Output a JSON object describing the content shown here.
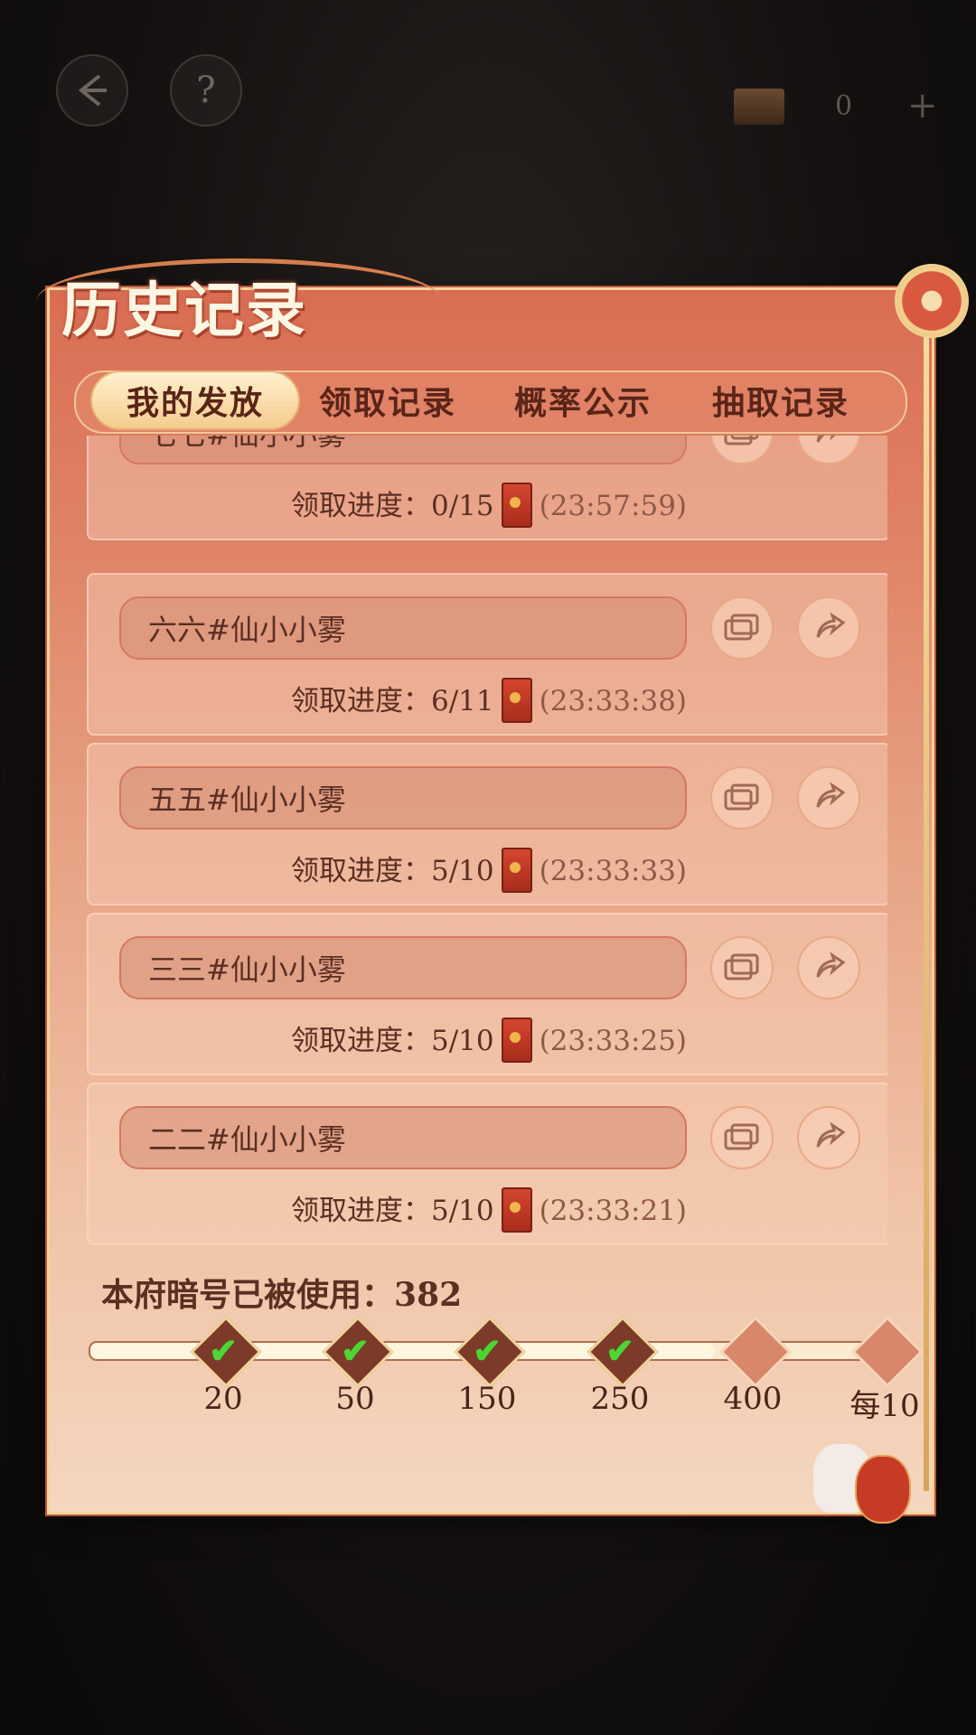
{
  "header": {
    "back_icon": "back-arrow-icon",
    "help_label": "?",
    "currency_value": "0",
    "plus_label": "+"
  },
  "title": "历史记录",
  "tabs": [
    {
      "label": "我的发放",
      "active": true
    },
    {
      "label": "领取记录",
      "active": false
    },
    {
      "label": "概率公示",
      "active": false
    },
    {
      "label": "抽取记录",
      "active": false
    }
  ],
  "records": [
    {
      "name": "七七#仙小小雾",
      "progress_label": "领取进度：",
      "progress": "0/15",
      "time": "(23:57:59)"
    },
    {
      "name": "六六#仙小小雾",
      "progress_label": "领取进度：",
      "progress": "6/11",
      "time": "(23:33:38)"
    },
    {
      "name": "五五#仙小小雾",
      "progress_label": "领取进度：",
      "progress": "5/10",
      "time": "(23:33:33)"
    },
    {
      "name": "三三#仙小小雾",
      "progress_label": "领取进度：",
      "progress": "5/10",
      "time": "(23:33:25)"
    },
    {
      "name": "二二#仙小小雾",
      "progress_label": "领取进度：",
      "progress": "5/10",
      "time": "(23:33:21)"
    }
  ],
  "usage": {
    "label": "本府暗号已被使用：",
    "count": "382",
    "fill_fraction": 0.78
  },
  "milestones": [
    {
      "label": "20",
      "reached": true
    },
    {
      "label": "50",
      "reached": true
    },
    {
      "label": "150",
      "reached": true
    },
    {
      "label": "250",
      "reached": true
    },
    {
      "label": "400",
      "reached": false
    },
    {
      "label": "每10",
      "reached": false
    }
  ],
  "colors": {
    "accent": "#d96d54",
    "check": "#4cd636",
    "text_dark": "#5b2f22"
  }
}
